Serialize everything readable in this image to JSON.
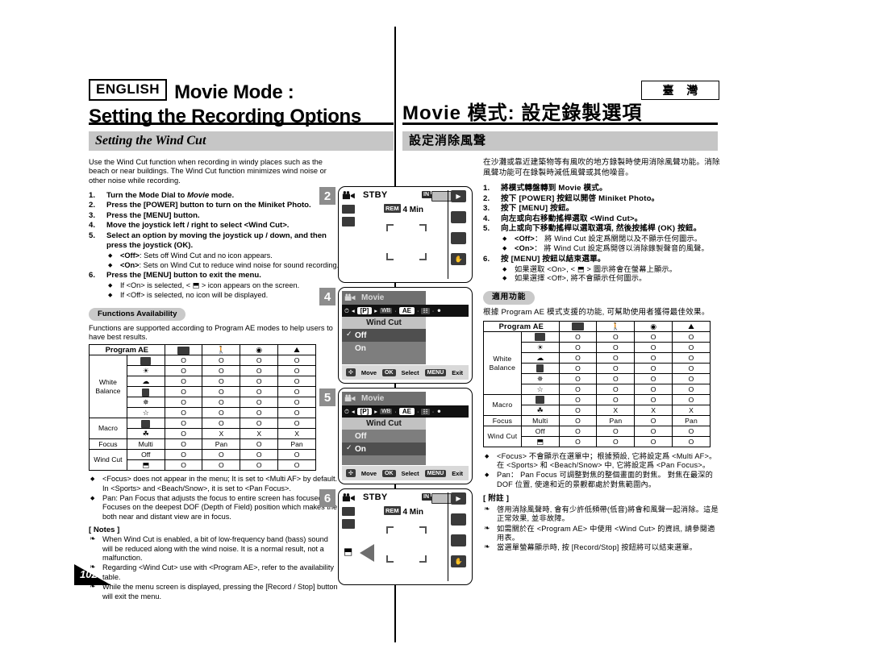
{
  "header": {
    "lang_badge": "ENGLISH",
    "title_line1": "Movie Mode :",
    "title_line2": "Setting the Recording Options",
    "region_badge": "臺 灣",
    "title_cjk": "Movie 模式: 設定錄製選項"
  },
  "section": {
    "title_en": "Setting the Wind Cut",
    "title_cjk": "設定消除風聲"
  },
  "english": {
    "intro": "Use the Wind Cut function when recording in windy places such as the beach or near buildings. The Wind Cut function minimizes wind noise or other noise while recording.",
    "steps": [
      {
        "num": "1.",
        "text": "Turn the Mode Dial to Movie mode.",
        "italic_word": "Movie"
      },
      {
        "num": "2.",
        "text": "Press the [POWER] button to turn on the Miniket Photo."
      },
      {
        "num": "3.",
        "text": "Press the [MENU] button."
      },
      {
        "num": "4.",
        "text": "Move the joystick left / right to select <Wind Cut>."
      },
      {
        "num": "5.",
        "text": "Select an option by moving the joystick up / down, and then press the joystick (OK).",
        "subs": [
          {
            "bold": "<Off>",
            "rest": ": Sets off Wind Cut and no icon appears."
          },
          {
            "bold": "<On>",
            "rest": ": Sets on Wind Cut to reduce wind noise for sound recording."
          }
        ]
      },
      {
        "num": "6.",
        "text": "Press the [MENU] button to exit the menu.",
        "subs": [
          {
            "bold": "",
            "rest": "If <On> is selected, < ⬒ > icon appears on the screen."
          },
          {
            "bold": "",
            "rest": "If <Off> is selected, no icon will be displayed."
          }
        ]
      }
    ],
    "availability_pill": "Functions Availability",
    "availability_intro": "Functions are supported according to Program AE modes to help users to have best results.",
    "table_notes": [
      "<Focus> does not appear in the menu; It is set to <Multi AF> by default.",
      "In <Sports> and <Beach/Snow>, it is set to <Pan Focus>.",
      "Pan: Pan Focus that adjusts the focus to entire screen has focused. Focuses on the deepest DOF (Depth of Field) position which makes the both near and distant view are in focus."
    ],
    "notes_title": "[ Notes ]",
    "notes": [
      "When Wind Cut is enabled, a bit of low-frequency band (bass) sound will be reduced along with the wind noise. It is a normal result, not a malfunction.",
      "Regarding <Wind Cut> use with <Program AE>, refer to the availability table.",
      "While the menu screen is displayed, pressing the [Record / Stop] button will exit the menu."
    ]
  },
  "chinese": {
    "intro": "在沙灘或靠近建築物等有風吹的地方錄製時使用消除風聲功能。消除風聲功能可在錄製時減低風聲或其他噪音。",
    "steps": [
      {
        "num": "1.",
        "text": "將模式轉盤轉到 Movie 模式。"
      },
      {
        "num": "2.",
        "text": "按下 [POWER] 按鈕以開啓 Miniket Photo。"
      },
      {
        "num": "3.",
        "text": "按下 [MENU] 按鈕。"
      },
      {
        "num": "4.",
        "text": "向左或向右移動搖桿選取 <Wind Cut>。"
      },
      {
        "num": "5.",
        "text": "向上或向下移動搖桿以選取選項, 然後按搖桿 (OK) 按鈕。",
        "subs": [
          {
            "bold": "<Off>",
            "rest": "： 將 Wind Cut 設定爲關閉以及不顯示任何圖示。"
          },
          {
            "bold": "<On>",
            "rest": "： 將 Wind Cut 設定爲開啓以消除錄製聲音的風聲。"
          }
        ]
      },
      {
        "num": "6.",
        "text": "按 [MENU] 按鈕以結束選單。",
        "subs": [
          {
            "bold": "",
            "rest": "如果選取 <On>, < ⬒ > 圖示將會在螢幕上顯示。"
          },
          {
            "bold": "",
            "rest": "如果選擇 <Off>, 將不會顯示任何圖示。"
          }
        ]
      }
    ],
    "availability_pill": "適用功能",
    "availability_intro": "根據 Program AE 模式支援的功能, 可幫助使用者獲得最佳效果。",
    "table_notes": [
      "<Focus> 不會顯示在選單中；根據預設, 它將設定爲 <Multi AF>。",
      "在 <Sports> 和 <Beach/Snow> 中, 它將設定爲 <Pan Focus>。",
      "Pan： Pan Focus 可調整對焦的整個畫面的對焦。 對焦在最深的 DOF 位置, 使遠和近的景觀都處於對焦範圍內。"
    ],
    "notes_title": "[ 附註 ]",
    "notes": [
      "啓用消除風聲時, 會有少許低頻帶(低音)將會和風聲一起消除。這是正常效果, 並非故障。",
      "如需關於在 <Program AE> 中使用 <Wind Cut> 的資訊, 請參閱適用表。",
      "當選單螢幕顯示時, 按 [Record/Stop] 按鈕將可以結束選單。"
    ]
  },
  "table": {
    "corner_header": "Program AE",
    "column_icons": [
      "auto-ae-icon",
      "sports-icon",
      "spotlight-icon",
      "beach-snow-icon"
    ],
    "groups": [
      {
        "label": "White Balance",
        "rows": [
          {
            "icon": "wb-auto-icon",
            "values": [
              "O",
              "O",
              "O",
              "O"
            ]
          },
          {
            "icon": "wb-daylight-icon",
            "values": [
              "O",
              "O",
              "O",
              "O"
            ]
          },
          {
            "icon": "wb-cloudy-icon",
            "values": [
              "O",
              "O",
              "O",
              "O"
            ]
          },
          {
            "icon": "wb-fluorescent-icon",
            "values": [
              "O",
              "O",
              "O",
              "O"
            ]
          },
          {
            "icon": "wb-tungsten-icon",
            "values": [
              "O",
              "O",
              "O",
              "O"
            ]
          },
          {
            "icon": "wb-custom-icon",
            "values": [
              "O",
              "O",
              "O",
              "O"
            ]
          }
        ]
      },
      {
        "label": "Macro",
        "rows": [
          {
            "icon": "macro-off-icon",
            "values": [
              "O",
              "O",
              "O",
              "O"
            ]
          },
          {
            "icon": "macro-on-icon",
            "values": [
              "O",
              "X",
              "X",
              "X"
            ]
          }
        ]
      },
      {
        "label": "Focus",
        "rows": [
          {
            "icon": "Multi",
            "text_icon": true,
            "values": [
              "O",
              "Pan",
              "O",
              "Pan"
            ]
          }
        ]
      },
      {
        "label": "Wind Cut",
        "rows": [
          {
            "icon": "Off",
            "text_icon": true,
            "values": [
              "O",
              "O",
              "O",
              "O"
            ]
          },
          {
            "icon": "wind-cut-icon",
            "values": [
              "O",
              "O",
              "O",
              "O"
            ]
          }
        ]
      }
    ]
  },
  "screens": [
    {
      "step": "2",
      "type": "stby",
      "status": "STBY",
      "memory_badge": "IN",
      "remaining_label": "REM",
      "remaining": "4 Min",
      "quality_icon": "640-icon",
      "mode_icon": "film-mode-icon",
      "side_icons": [
        "play-icon",
        "quality-auto-icon",
        "multi-af-icon",
        "wb-hand-icon"
      ],
      "wind_cut_indicator": false
    },
    {
      "step": "4",
      "type": "menu",
      "title": "Movie",
      "tab_selected": "[P]",
      "submenu": "Wind Cut",
      "options": [
        {
          "label": "Off",
          "checked": true,
          "selected": true
        },
        {
          "label": "On",
          "checked": false,
          "selected": false
        }
      ],
      "footer": [
        {
          "key": "joystick-icon",
          "label": "Move"
        },
        {
          "key": "OK",
          "label": "Select"
        },
        {
          "key": "MENU",
          "label": "Exit"
        }
      ]
    },
    {
      "step": "5",
      "type": "menu",
      "title": "Movie",
      "tab_selected": "[P]",
      "submenu": "Wind Cut",
      "options": [
        {
          "label": "Off",
          "checked": false,
          "selected": false
        },
        {
          "label": "On",
          "checked": true,
          "selected": true
        }
      ],
      "footer": [
        {
          "key": "joystick-icon",
          "label": "Move"
        },
        {
          "key": "OK",
          "label": "Select"
        },
        {
          "key": "MENU",
          "label": "Exit"
        }
      ]
    },
    {
      "step": "6",
      "type": "stby",
      "status": "STBY",
      "memory_badge": "IN",
      "remaining_label": "REM",
      "remaining": "4 Min",
      "quality_icon": "640-icon",
      "mode_icon": "film-mode-icon",
      "side_icons": [
        "play-icon",
        "quality-auto-icon",
        "multi-af-icon",
        "wb-hand-icon"
      ],
      "wind_cut_indicator": true
    }
  ],
  "page_number": "102"
}
